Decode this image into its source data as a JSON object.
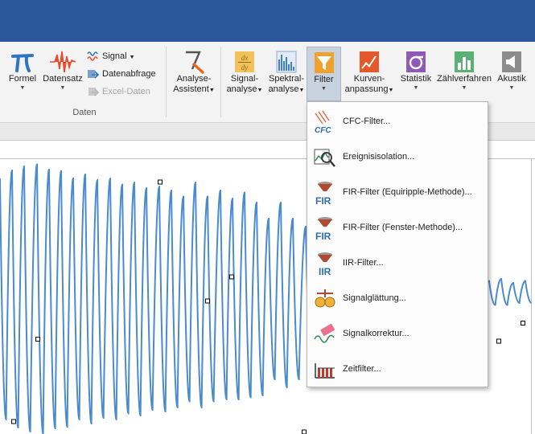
{
  "ribbon": {
    "formel": "Formel",
    "datensatz": "Datensatz",
    "signal": "Signal",
    "datenabfrage": "Datenabfrage",
    "excel_daten": "Excel-Daten",
    "group_daten": "Daten",
    "analyse_assistent_1": "Analyse-",
    "analyse_assistent_2": "Assistent",
    "signal_analyse_1": "Signal-",
    "signal_analyse_2": "analyse",
    "spektral_analyse_1": "Spektral-",
    "spektral_analyse_2": "analyse",
    "filter": "Filter",
    "kurven_1": "Kurven-",
    "kurven_2": "anpassung",
    "statistik": "Statistik",
    "zaehlverfahren": "Zählverfahren",
    "akustik": "Akustik"
  },
  "icons": {
    "formel": "pi-icon",
    "datensatz": "waveform-icon",
    "signal": "signal-icon",
    "datenabfrage": "data-query-icon",
    "excel_daten": "excel-data-icon",
    "analyse_assistent": "analysis-wizard-icon",
    "signal_analyse": "derivative-icon",
    "spektral_analyse": "spectrum-icon",
    "filter": "funnel-icon",
    "kurven": "curve-fit-icon",
    "statistik": "sigma-icon",
    "zaehlverfahren": "bar-chart-icon",
    "akustik": "speaker-icon"
  },
  "colors": {
    "titlebar": "#2b579a",
    "signal_line": "#4a8bd0",
    "active_button": "#c9d3df"
  },
  "filter_menu": {
    "items": [
      {
        "label": "CFC-Filter...",
        "icon": "cfc-filter-icon"
      },
      {
        "label": "Ereignisisolation...",
        "icon": "event-isolation-icon"
      },
      {
        "label": "FIR-Filter (Equiripple-Methode)...",
        "icon": "fir-equiripple-icon"
      },
      {
        "label": "FIR-Filter (Fenster-Methode)...",
        "icon": "fir-window-icon"
      },
      {
        "label": "IIR-Filter...",
        "icon": "iir-filter-icon"
      },
      {
        "label": "Signalglättung...",
        "icon": "signal-smoothing-icon"
      },
      {
        "label": "Signalkorrektur...",
        "icon": "signal-correction-icon"
      },
      {
        "label": "Zeitfilter...",
        "icon": "time-filter-icon"
      }
    ]
  },
  "chart_data": {
    "type": "line",
    "series": [
      {
        "x": [
          0,
          15,
          30,
          46,
          61,
          76,
          91,
          106,
          121,
          137,
          152,
          167,
          182,
          198,
          213,
          228,
          243,
          258,
          274,
          289,
          304,
          319,
          334,
          349,
          364,
          380,
          395,
          410,
          425,
          440,
          456,
          471,
          486,
          501,
          516,
          532,
          547,
          562,
          577,
          592,
          608,
          623,
          638,
          653
        ],
        "peaks": [
          300,
          320,
          330,
          335,
          322,
          318,
          300,
          310,
          296,
          300,
          285,
          290,
          276,
          280,
          270,
          255,
          290,
          255,
          270,
          250,
          265,
          240,
          200,
          240,
          200,
          180,
          110,
          130,
          100,
          80,
          110,
          90,
          70,
          60,
          80,
          60,
          70,
          55,
          45,
          60,
          45,
          50,
          40,
          45
        ],
        "troughs": [
          -300,
          -320,
          -330,
          -335,
          -322,
          -318,
          -300,
          -310,
          -296,
          -300,
          -285,
          -290,
          -276,
          -280,
          -270,
          -255,
          -270,
          -255,
          -250,
          -250,
          -245,
          -240,
          -200,
          -220,
          -200,
          -180,
          -110,
          -100,
          -90,
          -80,
          -70,
          -60,
          -55,
          -45,
          -40,
          -35,
          -30,
          -25,
          -20,
          -20,
          -15,
          -15,
          -10,
          -10
        ]
      }
    ],
    "markers": [
      {
        "x": 17,
        "y": -305
      },
      {
        "x": 47,
        "y": -100
      },
      {
        "x": 199,
        "y": 291
      },
      {
        "x": 258,
        "y": -5
      },
      {
        "x": 288,
        "y": 55
      },
      {
        "x": 378,
        "y": -335
      },
      {
        "x": 470,
        "y": -55
      },
      {
        "x": 500,
        "y": -85
      },
      {
        "x": 530,
        "y": -105
      },
      {
        "x": 560,
        "y": -60
      },
      {
        "x": 590,
        "y": -60
      },
      {
        "x": 620,
        "y": -105
      },
      {
        "x": 650,
        "y": -60
      }
    ]
  }
}
